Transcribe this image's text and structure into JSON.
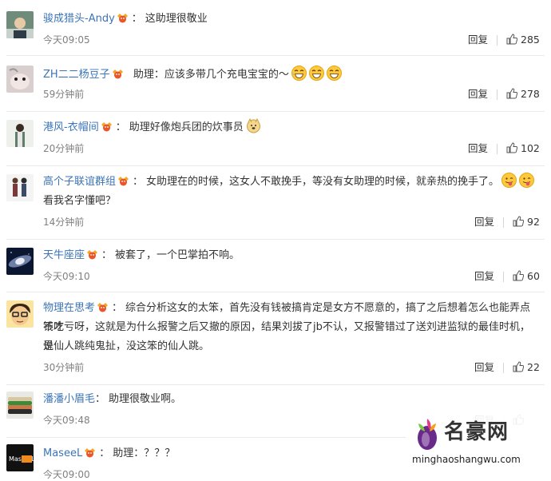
{
  "comments": [
    {
      "user": "骏成猎头-Andy",
      "text": "这助理很敬业",
      "text2": "",
      "time": "今天09:05",
      "reply": "回复",
      "likes": "285",
      "emojis": []
    },
    {
      "user": "ZH二二杨豆子",
      "text": "助理：应该多带几个充电宝宝的～",
      "text2": "",
      "time": "59分钟前",
      "reply": "回复",
      "likes": "278",
      "emojis": [
        "laugh-tears-emoji",
        "laugh-tears-emoji",
        "laugh-tears-emoji"
      ]
    },
    {
      "user": "港风-衣帽间",
      "text": "助理好像炮兵团的炊事员",
      "text2": "",
      "time": "20分钟前",
      "reply": "回复",
      "likes": "102",
      "emojis": [
        "doge-emoji"
      ]
    },
    {
      "user": "高个子联谊群组",
      "text": "女助理在的时候，这女人不敢挽手，等没有女助理的时候，就亲热的挽手了。",
      "text2": "看我名字懂吧？",
      "time": "14分钟前",
      "reply": "回复",
      "likes": "92",
      "emojis": [
        "tongue-emoji",
        "tongue-emoji"
      ]
    },
    {
      "user": "天牛座座",
      "text": "被套了，一个巴掌拍不响。",
      "text2": "",
      "time": "今天09:10",
      "reply": "回复",
      "likes": "60",
      "emojis": []
    },
    {
      "user": "物理在思考",
      "text": "综合分析这女的太笨，首先没有钱被搞肯定是女方不愿意的，搞了之后想着怎么也能弄点钱才",
      "text2": "不吃亏呀，这就是为什么报警之后又撤的原因，结果刘拔了jb不认，又报警错过了送刘进监狱的最佳时机，说",
      "text3": "是仙人跳纯鬼扯，没这笨的仙人跳。",
      "time": "30分钟前",
      "reply": "回复",
      "likes": "22",
      "emojis": []
    },
    {
      "user": "潘潘小眉毛",
      "text": "助理很敬业啊。",
      "text2": "",
      "time": "今天09:48",
      "reply": "回复",
      "likes": "",
      "emojis": []
    },
    {
      "user": "MaseeL",
      "text": "助理：？？？",
      "text2": "",
      "time": "今天09:00",
      "reply": "",
      "likes": "",
      "emojis": []
    }
  ],
  "avatar_labels": {
    "m8": "Mas eeL"
  },
  "watermark": {
    "cn": "名豪网",
    "url": "minghaoshangwu.com"
  },
  "colors": {
    "username": "#3b74b8",
    "meta": "#808080",
    "divider": "#e9e9e9",
    "badge": "#f5a623"
  }
}
